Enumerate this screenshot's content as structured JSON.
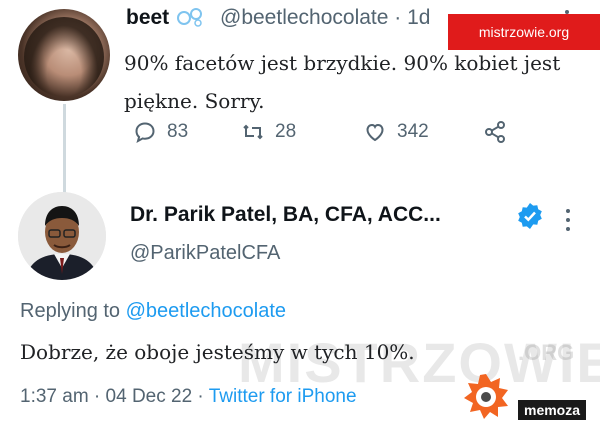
{
  "tweet1": {
    "display_name": "beet",
    "handle_time": "@beetlechocolate · 1d",
    "text": "90% facetów jest brzydkie. 90% kobiet jest piękne. Sorry.",
    "replies": "83",
    "retweets": "28",
    "likes": "342"
  },
  "watermark_top": "mistrzowie.org",
  "tweet2": {
    "display_name": "Dr. Parik Patel, BA, CFA, ACC...",
    "handle": "@ParikPatelCFA",
    "replying_prefix": "Replying to ",
    "replying_to": "@beetlechocolate",
    "text": "Dobrze, że oboje jesteśmy w tych 10%.",
    "time_date": "1:37 am · 04 Dec 22 · ",
    "source": "Twitter for iPhone"
  },
  "watermark_big": "MISTRZOWIE",
  "watermark_org": ".ORG",
  "memoza": "memoza",
  "colors": {
    "accent": "#1d9bf0",
    "secondary_text": "#536471",
    "watermark_red": "#e01b1b",
    "memoza_orange": "#f26522"
  },
  "icons": [
    "reply-icon",
    "retweet-icon",
    "like-icon",
    "share-icon",
    "verified-icon",
    "more-icon"
  ]
}
